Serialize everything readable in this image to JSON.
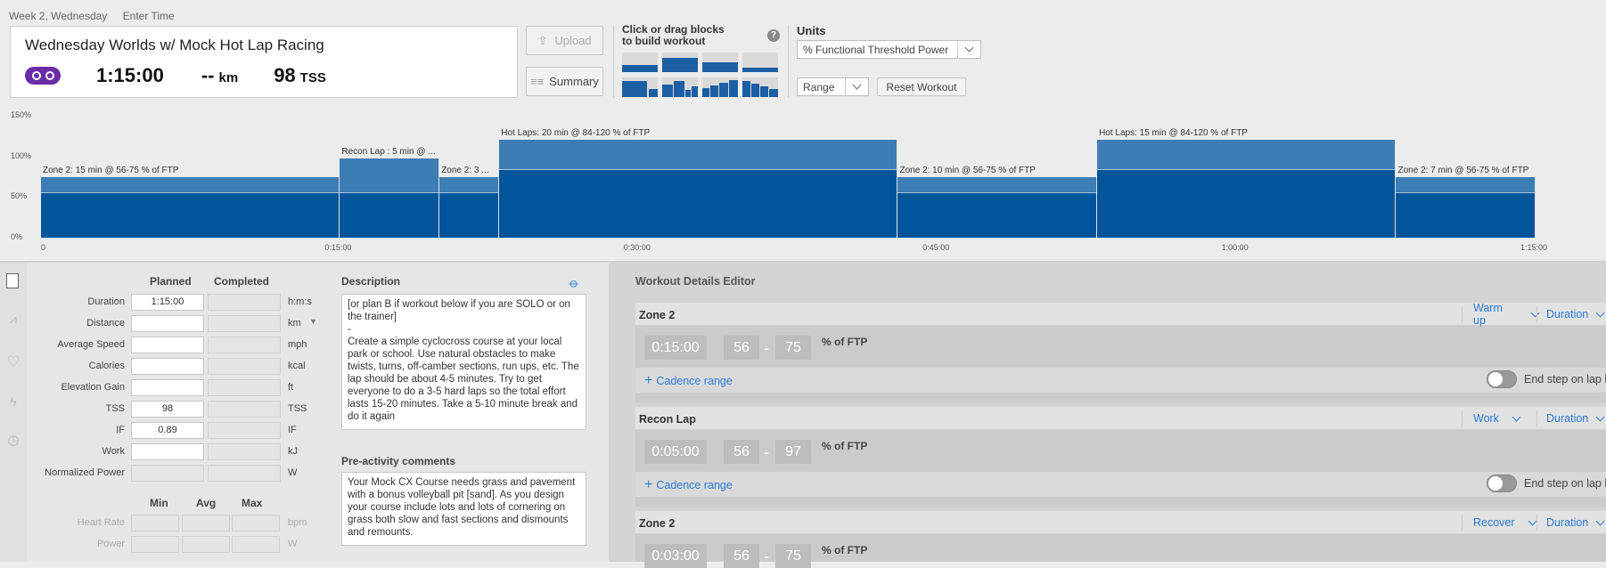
{
  "breadcrumb": {
    "day": "Week 2, Wednesday",
    "enter_time": "Enter Time"
  },
  "workout": {
    "title": "Wednesday Worlds w/ Mock Hot Lap Racing",
    "duration": "1:15:00",
    "distance": "--",
    "distance_unit": "km",
    "tss": "98",
    "tss_unit": "TSS"
  },
  "buttons": {
    "upload": "Upload",
    "summary": "Summary",
    "reset": "Reset Workout"
  },
  "blocks": {
    "label_line1": "Click or drag blocks",
    "label_line2": "to build workout",
    "help": "?"
  },
  "units": {
    "label": "Units",
    "selected": "% Functional Threshold Power",
    "range": "Range"
  },
  "chart_data": {
    "type": "area",
    "y_ticks": [
      "150%",
      "100%",
      "50%",
      "0%"
    ],
    "ylim": [
      0,
      150
    ],
    "x_ticks": [
      "0",
      "0:15:00",
      "0:30:00",
      "0:45:00",
      "1:00:00",
      "1:15:00"
    ],
    "xlim_min": [
      0,
      75
    ],
    "segments": [
      {
        "label": "Zone 2: 15 min @ 56-75 % of FTP",
        "start": 0,
        "end": 15,
        "low": 56,
        "high": 75
      },
      {
        "label": "Recon Lap : 5 min @ ...",
        "start": 15,
        "end": 20,
        "low": 56,
        "high": 97
      },
      {
        "label": "Zone 2: 3 ...",
        "start": 20,
        "end": 23,
        "low": 56,
        "high": 75
      },
      {
        "label": "Hot Laps: 20 min @ 84-120 % of FTP",
        "start": 23,
        "end": 43,
        "low": 84,
        "high": 120
      },
      {
        "label": "Zone 2: 10 min @ 56-75 % of FTP",
        "start": 43,
        "end": 53,
        "low": 56,
        "high": 75
      },
      {
        "label": "Hot Laps: 15 min @ 84-120 % of FTP",
        "start": 53,
        "end": 68,
        "low": 84,
        "high": 120
      },
      {
        "label": "Zone 2: 7 min @ 56-75 % of FTP",
        "start": 68,
        "end": 75,
        "low": 56,
        "high": 75
      }
    ]
  },
  "details": {
    "col_planned": "Planned",
    "col_completed": "Completed",
    "rows": [
      {
        "label": "Duration",
        "planned": "1:15:00",
        "unit": "h:m:s"
      },
      {
        "label": "Distance",
        "planned": "",
        "unit": "km"
      },
      {
        "label": "Average Speed",
        "planned": "",
        "unit": "mph"
      },
      {
        "label": "Calories",
        "planned": "",
        "unit": "kcal"
      },
      {
        "label": "Elevation Gain",
        "planned": "",
        "unit": "ft"
      },
      {
        "label": "TSS",
        "planned": "98",
        "unit": "TSS"
      },
      {
        "label": "IF",
        "planned": "0.89",
        "unit": "IF"
      },
      {
        "label": "Work",
        "planned": "",
        "unit": "kJ"
      },
      {
        "label": "Normalized Power",
        "planned": "",
        "unit": "W"
      }
    ],
    "col_min": "Min",
    "col_avg": "Avg",
    "col_max": "Max",
    "range_rows": [
      {
        "label": "Heart Rate",
        "unit": "bpm"
      },
      {
        "label": "Power",
        "unit": "W"
      }
    ]
  },
  "description": {
    "title": "Description",
    "text": "[or plan B if workout below if you are SOLO or on the trainer]\n-\nCreate a simple cyclocross course at your local park or school. Use natural obstacles to make twists, turns, off-camber sections, run ups, etc. The lap should be about 4-5 minutes. Try to get everyone to do a 3-5 hard laps so the total effort lasts 15-20 minutes. Take a 5-10 minute break and do it again"
  },
  "pre_comments": {
    "title": "Pre-activity comments",
    "text": "Your Mock CX Course needs grass and pavement with a bonus volleyball pit [sand]. As you design your course include lots and lots of cornering on grass both slow and fast sections and dismounts and remounts."
  },
  "editor": {
    "title": "Workout Details Editor",
    "cadence": "Cadence range",
    "end_lap": "End step on lap b",
    "pct_ftp": "% of FTP",
    "steps": [
      {
        "name": "Zone 2",
        "type": "Warm up",
        "mode": "Duration",
        "time": "0:15:00",
        "low": "56",
        "high": "75"
      },
      {
        "name": "Recon Lap",
        "type": "Work",
        "mode": "Duration",
        "time": "0:05:00",
        "low": "56",
        "high": "97"
      },
      {
        "name": "Zone 2",
        "type": "Recover",
        "mode": "Duration",
        "time": "0:03:00",
        "low": "56",
        "high": "75"
      }
    ]
  }
}
